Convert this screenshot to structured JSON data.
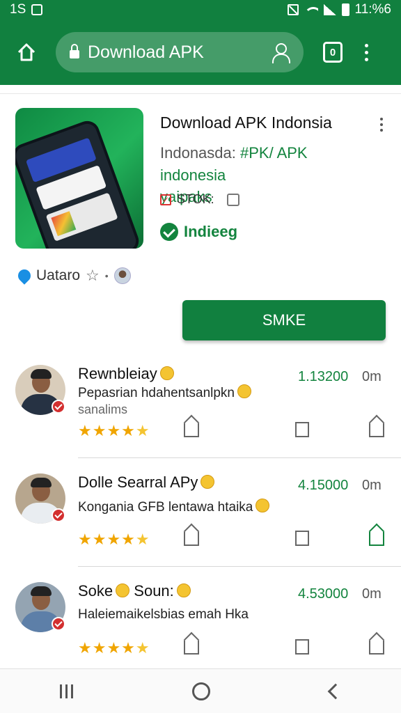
{
  "status_bar": {
    "left_text": "1S",
    "time": "11:%6"
  },
  "browser": {
    "address_text": "Download APK",
    "tabs_count": "0"
  },
  "app": {
    "name": "Download APK Indonsia",
    "subtitle_gray": "Indonasda: ",
    "subtitle_green": "#PK/ APK indonesia",
    "subtitle_line2": "yaipaks",
    "stock_label": "STOK:",
    "verified_label": "Indieeg",
    "developer": "Uataro",
    "cta_label": "SMKE"
  },
  "reviews": [
    {
      "name": "Rewnbleiay",
      "text": "Pepasrian hdahentsanlpkn",
      "sub": "sanalims",
      "score": "1.13200",
      "time": "0m",
      "stars": "★★★★",
      "last_star": "★",
      "share_active": false
    },
    {
      "name": "Dolle Searral APy",
      "text": "Kongania GFB lentawa htaika",
      "sub": "",
      "score": "4.15000",
      "time": "0m",
      "stars": "★★★★",
      "last_star": "★",
      "share_active": true
    },
    {
      "name": "Soke",
      "name2": "Soun:",
      "text": "Haleiemaikelsbias emah Hka",
      "sub": "",
      "score": "4.53000",
      "time": "0m",
      "stars": "★★★★",
      "last_star": "★",
      "share_active": false
    }
  ],
  "colors": {
    "brand_green": "#11803f",
    "star_gold": "#f0a500",
    "badge_red": "#d32f2f"
  }
}
